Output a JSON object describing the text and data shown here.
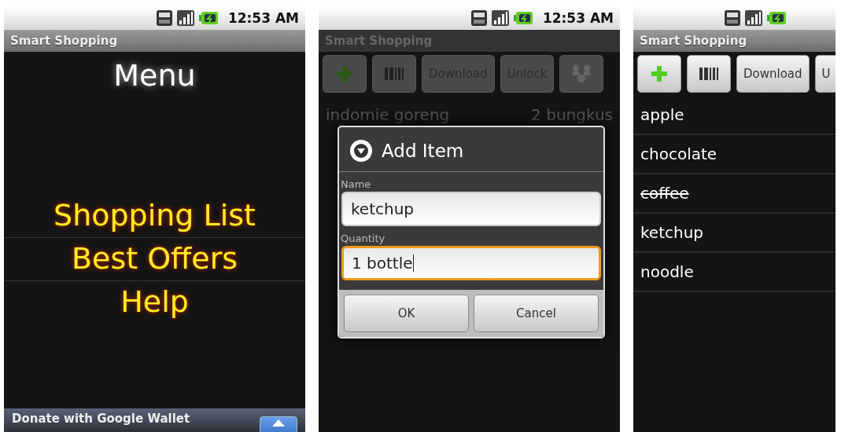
{
  "screens": [
    {
      "kind": "menu",
      "status": {
        "time": "12:53 AM"
      },
      "title": "Smart Shopping",
      "heading": "Menu",
      "items": [
        "Shopping List",
        "Best Offers",
        "Help"
      ],
      "ad": {
        "text": "Donate with Google Wallet"
      }
    },
    {
      "kind": "list",
      "status": {
        "time": "12:53 AM"
      },
      "title": "Smart Shopping",
      "toolbar": [
        {
          "kind": "add"
        },
        {
          "kind": "barcode"
        },
        {
          "kind": "text",
          "label": "Download"
        },
        {
          "kind": "text",
          "label": "Unlock"
        },
        {
          "kind": "share"
        }
      ],
      "items": [
        {
          "name": "indomie goreng",
          "quantity": "2 bungkus",
          "crossed": false
        }
      ],
      "dialog": {
        "title": "Add Item",
        "fields": [
          {
            "label": "Name",
            "value": "ketchup",
            "focused": false
          },
          {
            "label": "Quantity",
            "value": "1 bottle",
            "focused": true
          }
        ],
        "buttons": [
          "OK",
          "Cancel"
        ]
      }
    },
    {
      "kind": "list",
      "title": "Smart Shopping",
      "toolbar": [
        {
          "kind": "add"
        },
        {
          "kind": "barcode"
        },
        {
          "kind": "text",
          "label": "Download"
        },
        {
          "kind": "text",
          "label": "U"
        }
      ],
      "items": [
        {
          "name": "apple",
          "crossed": false
        },
        {
          "name": "chocolate",
          "crossed": false
        },
        {
          "name": "coffee",
          "crossed": true
        },
        {
          "name": "ketchup",
          "crossed": false
        },
        {
          "name": "noodle",
          "crossed": false
        }
      ]
    }
  ]
}
